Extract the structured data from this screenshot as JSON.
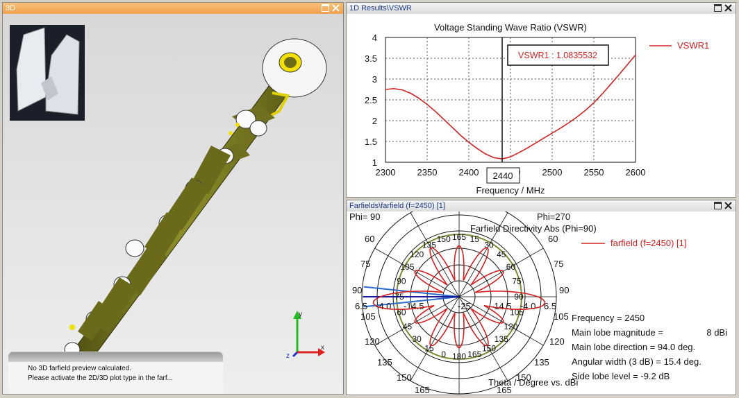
{
  "panels": {
    "view3d": {
      "title": "3D"
    },
    "results": {
      "title": "1D Results\\VSWR"
    },
    "farfield": {
      "title": "Farfields\\farfield (f=2450) [1]"
    }
  },
  "message": {
    "line1": "No 3D farfield preview calculated.",
    "line2": "Please activate the 2D/3D plot type in the farf..."
  },
  "axes3d": {
    "x": "x",
    "y": "y",
    "z": "z"
  },
  "vswr_chart": {
    "chart_data": {
      "type": "line",
      "title": "Voltage Standing Wave Ratio (VSWR)",
      "xlabel": "Frequency / MHz",
      "ylabel": "",
      "xlim": [
        2300,
        2600
      ],
      "ylim": [
        1,
        4
      ],
      "xticks": [
        "2300",
        "2350",
        "2400",
        "2450",
        "2500",
        "2550",
        "2600"
      ],
      "yticks": [
        "1",
        "1.5",
        "2",
        "2.5",
        "3",
        "3.5",
        "4"
      ],
      "grid": true,
      "legend_position": "top-right",
      "series": [
        {
          "name": "VSWR1",
          "color": "#d42020",
          "x": [
            2300,
            2310,
            2320,
            2330,
            2340,
            2350,
            2360,
            2370,
            2380,
            2390,
            2400,
            2410,
            2420,
            2430,
            2440,
            2450,
            2460,
            2470,
            2480,
            2490,
            2500,
            2510,
            2520,
            2530,
            2540,
            2550,
            2560,
            2570,
            2580,
            2590,
            2600
          ],
          "y": [
            2.75,
            2.77,
            2.74,
            2.66,
            2.54,
            2.39,
            2.22,
            2.03,
            1.84,
            1.65,
            1.48,
            1.33,
            1.2,
            1.11,
            1.08,
            1.13,
            1.23,
            1.34,
            1.46,
            1.58,
            1.7,
            1.82,
            1.95,
            2.09,
            2.25,
            2.43,
            2.64,
            2.87,
            3.1,
            3.34,
            3.58
          ]
        }
      ],
      "marker": {
        "x": 2440,
        "label": "VSWR1 : 1.0835532",
        "x_label": "2440"
      }
    }
  },
  "polar_chart": {
    "chart_data": {
      "type": "polar",
      "title": "Farfield Directivity Abs (Phi=90)",
      "legend": "farfield (f=2450) [1]",
      "series_color": "#d42020",
      "top_left_label": "Phi= 90",
      "top_right_label": "Phi=270",
      "bottom_label": "Theta / Degree vs. dBi",
      "outer_angle_labels": [
        "90",
        "60",
        "75",
        "90",
        "105",
        "120",
        "135",
        "150",
        "165",
        "60",
        "75",
        "90",
        "105",
        "120",
        "135",
        "150",
        "165"
      ],
      "inner_angle_labels": [
        "15",
        "30",
        "45",
        "60",
        "75",
        "90",
        "105",
        "120",
        "135",
        "150",
        "165",
        "180",
        "0",
        "15",
        "30",
        "45",
        "60",
        "75",
        "90",
        "105",
        "120",
        "135",
        "150",
        "165"
      ],
      "radial_labels": [
        "6.5",
        "-4.0",
        "-14.5",
        "-25",
        "-14.5",
        "-4.0",
        "6.5"
      ],
      "frequency": "Frequency = 2450",
      "main_lobe_magnitude_label": "Main lobe magnitude =",
      "main_lobe_magnitude": "8 dBi",
      "main_lobe_direction": "Main lobe direction =  94.0 deg.",
      "angular_width": "Angular width (3 dB) =   15.4 deg.",
      "side_lobe_level": "Side lobe level =    -9.2 dB",
      "main_lobe_deg": 94,
      "lobes_deg": [
        0,
        30,
        60,
        94,
        120,
        150,
        180,
        210,
        240,
        266,
        300,
        330
      ],
      "lobe_levels": [
        0.55,
        0.62,
        0.55,
        1.0,
        0.55,
        0.62,
        0.55,
        0.62,
        0.55,
        1.0,
        0.55,
        0.62
      ]
    }
  }
}
